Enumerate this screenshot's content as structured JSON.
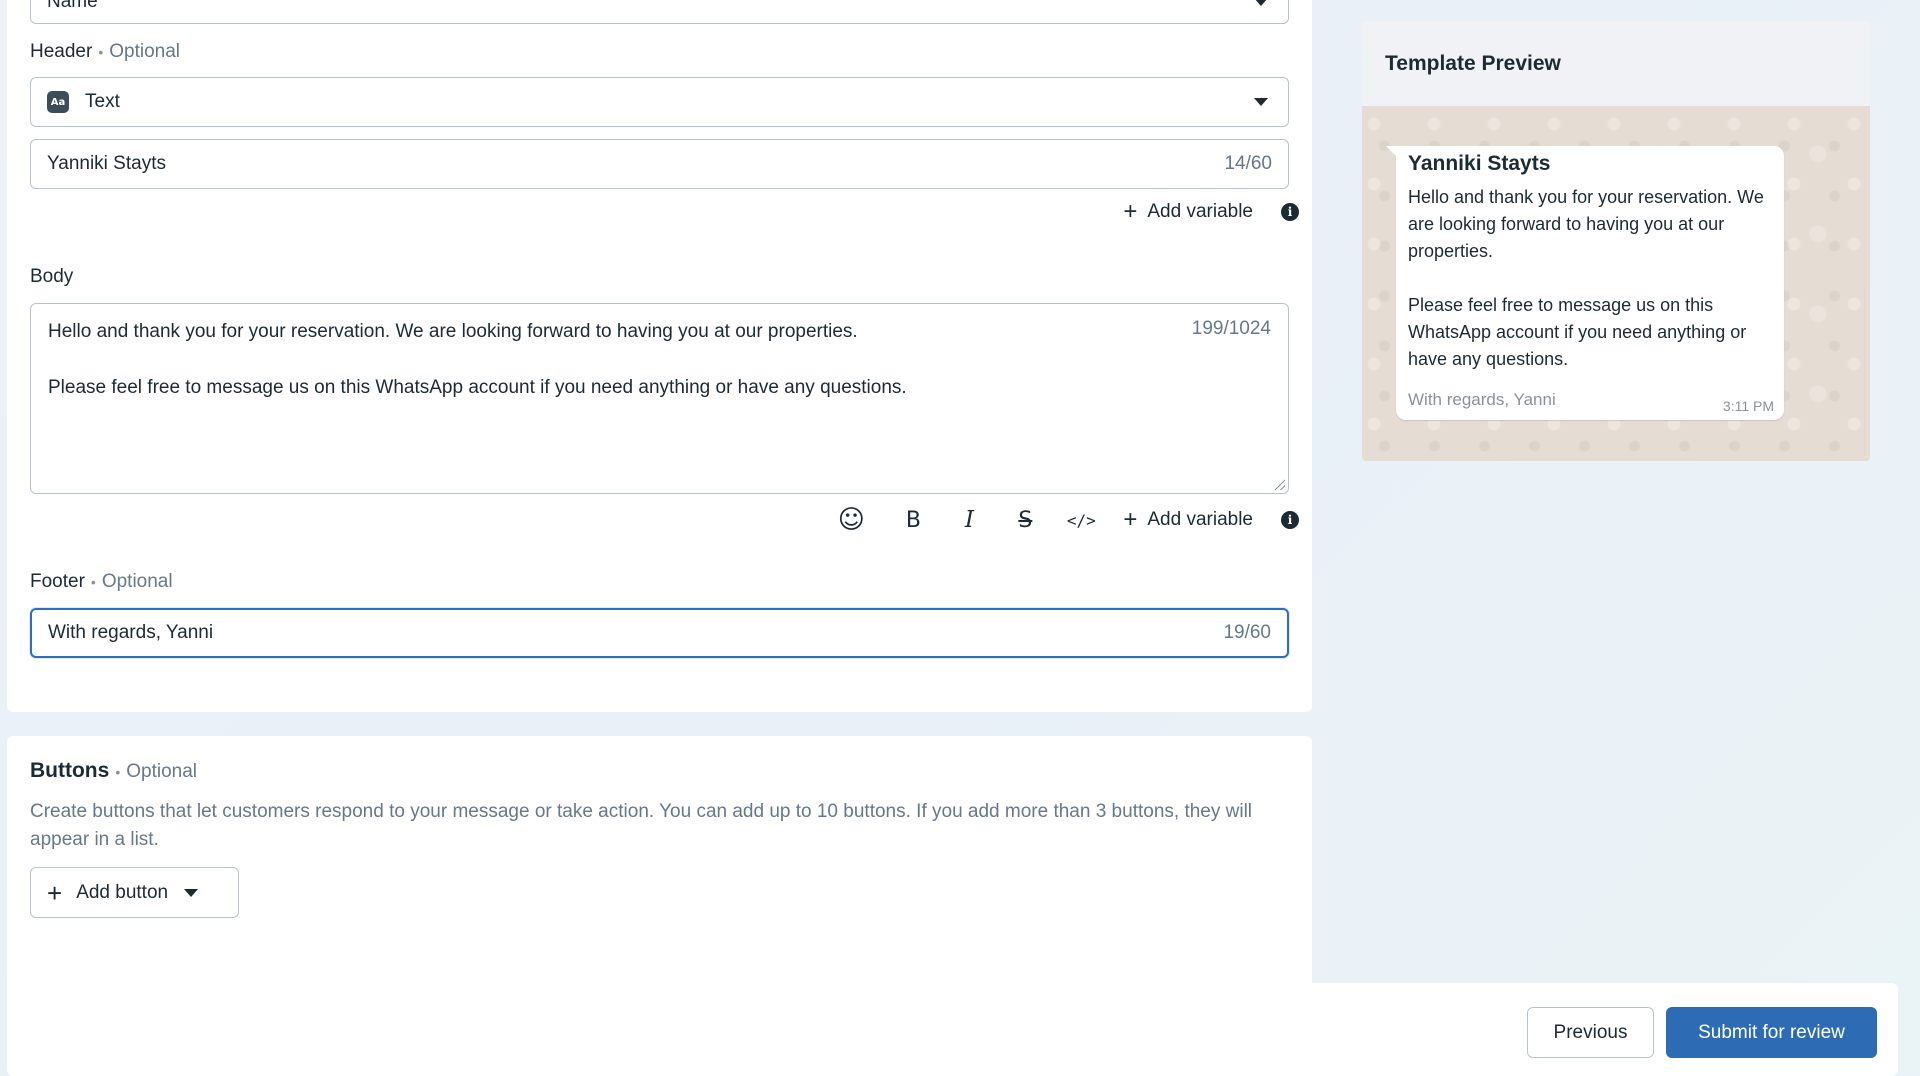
{
  "top_select": {
    "value": "Name"
  },
  "header": {
    "label": "Header",
    "optional": "Optional",
    "type_badge": "Aa",
    "type_value": "Text",
    "input_value": "Yanniki Stayts",
    "counter": "14/60",
    "add_variable": "Add variable"
  },
  "body": {
    "label": "Body",
    "line1": "Hello and thank you for your reservation. We are looking forward to having you at our properties.",
    "line2": "Please feel free to message us on this WhatsApp account if you need anything or have any questions.",
    "counter": "199/1024",
    "add_variable": "Add variable",
    "toolbar": {
      "emoji_glyph": "☺",
      "bold_glyph": "B",
      "italic_glyph": "I",
      "strike_glyph": "S",
      "code_glyph": "</>"
    }
  },
  "footer": {
    "label": "Footer",
    "optional": "Optional",
    "input_value": "With regards, Yanni",
    "counter": "19/60"
  },
  "buttons_section": {
    "title": "Buttons",
    "optional": "Optional",
    "description": "Create buttons that let customers respond to your message or take action. You can add up to 10 buttons. If you add more than 3 buttons, they will appear in a list.",
    "add_button": "Add button"
  },
  "preview": {
    "title": "Template Preview",
    "header": "Yanniki Stayts",
    "body_para1": "Hello and thank you for your reservation. We are looking forward to having you at our properties.",
    "body_para2": "Please feel free to message us on this WhatsApp account if you need anything or have any questions.",
    "footer": "With regards, Yanni",
    "time": "3:11 PM"
  },
  "bottom_bar": {
    "previous": "Previous",
    "submit": "Submit for review"
  },
  "colors": {
    "accent": "#2d6cb4",
    "focus_border": "#2c6fc2",
    "chat_bg": "#e5ddd3"
  }
}
